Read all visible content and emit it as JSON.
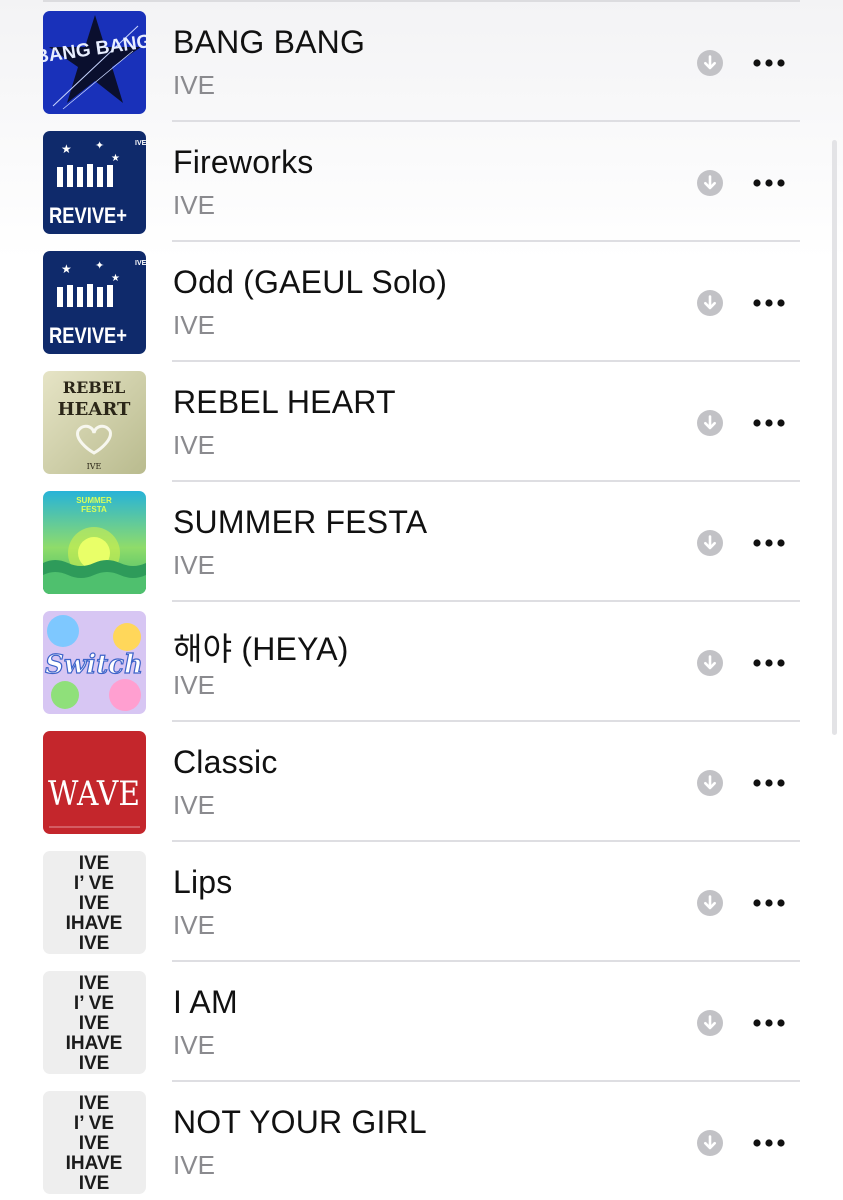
{
  "tracks": [
    {
      "title": "BANG BANG",
      "artist": "IVE",
      "artwork": "bangbang",
      "artwork_text": "BANG BANG"
    },
    {
      "title": "Fireworks",
      "artist": "IVE",
      "artwork": "revive",
      "artwork_text": "REVIVE+"
    },
    {
      "title": "Odd (GAEUL Solo)",
      "artist": "IVE",
      "artwork": "revive",
      "artwork_text": "REVIVE+"
    },
    {
      "title": "REBEL HEART",
      "artist": "IVE",
      "artwork": "rebel",
      "artwork_text": "REBEL HEART"
    },
    {
      "title": "SUMMER FESTA",
      "artist": "IVE",
      "artwork": "summer",
      "artwork_text": "SUMMER FESTA"
    },
    {
      "title": "해야 (HEYA)",
      "artist": "IVE",
      "artwork": "switch",
      "artwork_text": "Switch"
    },
    {
      "title": "Classic",
      "artist": "IVE",
      "artwork": "wave",
      "artwork_text": "WAVE"
    },
    {
      "title": "Lips",
      "artist": "IVE",
      "artwork": "ihave",
      "artwork_text": "IVE I'VE IVE IHAVE IVE"
    },
    {
      "title": "I AM",
      "artist": "IVE",
      "artwork": "ihave",
      "artwork_text": "IVE I'VE IVE IHAVE IVE"
    },
    {
      "title": "NOT YOUR GIRL",
      "artist": "IVE",
      "artwork": "ihave",
      "artwork_text": "IVE I'VE IVE IHAVE IVE"
    }
  ],
  "icons": {
    "download": "download-icon",
    "more": "more-icon"
  },
  "colors": {
    "title": "#111111",
    "artist": "#8a8a8e",
    "download_bg": "#c2c2c6",
    "separator": "#dedee2"
  }
}
